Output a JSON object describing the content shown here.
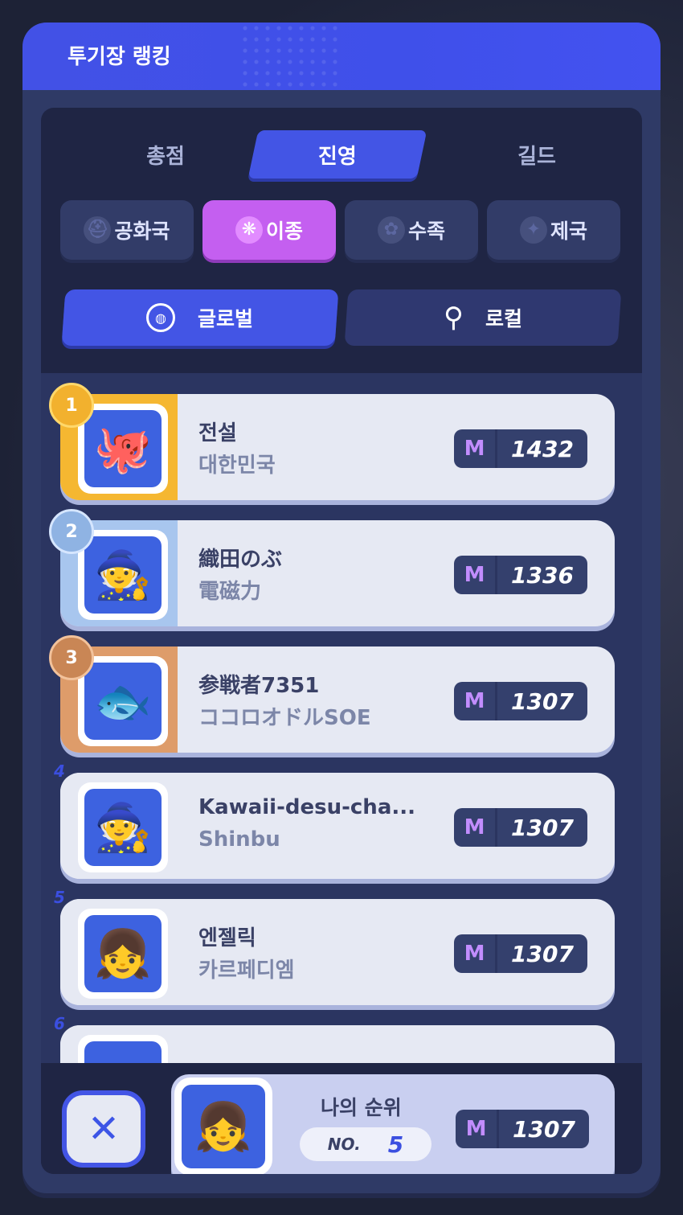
{
  "title": "투기장 랭킹",
  "tabs": [
    {
      "label": "총점",
      "active": false
    },
    {
      "label": "진영",
      "active": true
    },
    {
      "label": "길드",
      "active": false
    }
  ],
  "factions": [
    {
      "label": "공화국",
      "icon": "helmet-icon",
      "active": false
    },
    {
      "label": "이종",
      "icon": "beast-icon",
      "active": true
    },
    {
      "label": "수족",
      "icon": "paw-icon",
      "active": false
    },
    {
      "label": "제국",
      "icon": "star-icon",
      "active": false
    }
  ],
  "regions": [
    {
      "label": "글로벌",
      "icon": "globe-icon",
      "active": true
    },
    {
      "label": "로컬",
      "icon": "location-pin-icon",
      "active": false
    }
  ],
  "rankings": [
    {
      "rank": "1",
      "name": "전설",
      "sub": "대한민국",
      "score": "1432",
      "medal": "gold"
    },
    {
      "rank": "2",
      "name": "織田のぶ",
      "sub": "電磁力",
      "score": "1336",
      "medal": "silver"
    },
    {
      "rank": "3",
      "name": "参戦者7351",
      "sub": "ココロオドルSOE",
      "score": "1307",
      "medal": "bronze"
    },
    {
      "rank": "4",
      "name": "Kawaii-desu-cha...",
      "sub": "Shinbu",
      "score": "1307",
      "medal": "none"
    },
    {
      "rank": "5",
      "name": "엔젤릭",
      "sub": "카르페디엠",
      "score": "1307",
      "medal": "none"
    },
    {
      "rank": "6",
      "name": "",
      "sub": "",
      "score": "",
      "medal": "none"
    }
  ],
  "my_rank": {
    "label": "나의 순위",
    "no_label": "NO.",
    "rank": "5",
    "score": "1307"
  },
  "close_label": "✕",
  "colors": {
    "header": "#4251e6",
    "accent": "#4355e5",
    "faction_active": "#c45ff0",
    "gold": "#f5b731",
    "silver": "#9fc0e8",
    "bronze": "#d99866"
  }
}
